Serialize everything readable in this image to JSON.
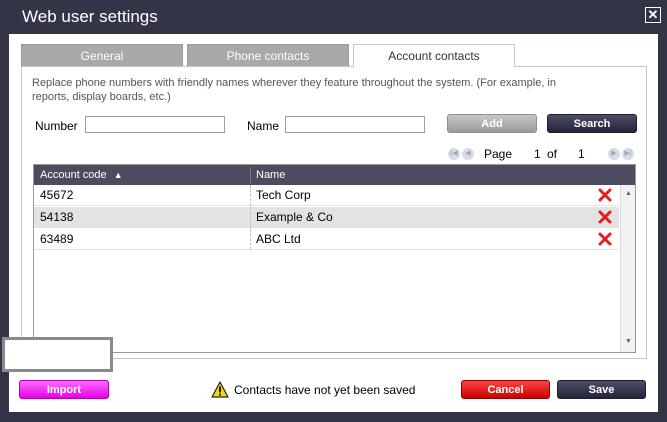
{
  "window": {
    "title": "Web user settings",
    "close_glyph": "✕"
  },
  "tabs": [
    {
      "label": "General",
      "active": false
    },
    {
      "label": "Phone contacts",
      "active": false
    },
    {
      "label": "Account contacts",
      "active": true
    }
  ],
  "description": "Replace phone numbers with friendly names wherever they feature throughout the system. (For example, in reports, display boards, etc.)",
  "form": {
    "number_label": "Number",
    "number_value": "",
    "name_label": "Name",
    "name_value": "",
    "add_label": "Add",
    "search_label": "Search"
  },
  "pager": {
    "page_label": "Page",
    "current": "1",
    "of_label": "of",
    "total": "1"
  },
  "table": {
    "columns": [
      {
        "label": "Account code",
        "sort": "▲"
      },
      {
        "label": "Name"
      }
    ],
    "rows": [
      {
        "code": "45672",
        "name": "Tech Corp"
      },
      {
        "code": "54138",
        "name": "Example & Co"
      },
      {
        "code": "63489",
        "name": "ABC Ltd"
      }
    ]
  },
  "footer": {
    "import_label": "Import",
    "warning_text": "Contacts have not yet been saved",
    "cancel_label": "Cancel",
    "save_label": "Save"
  },
  "icons": {
    "close": "close-icon",
    "warning": "warning-icon",
    "delete": "delete-x-icon",
    "pager_first": "first-page-icon",
    "pager_prev": "prev-page-icon",
    "pager_next": "next-page-icon",
    "pager_last": "last-page-icon"
  },
  "colors": {
    "title_bar": "#343447",
    "header_bg": "#4c4c60",
    "import": "#ff33ff",
    "cancel": "#e60000",
    "save": "#2d2d44",
    "delete": "#e02020",
    "warning": "#f5d800"
  }
}
